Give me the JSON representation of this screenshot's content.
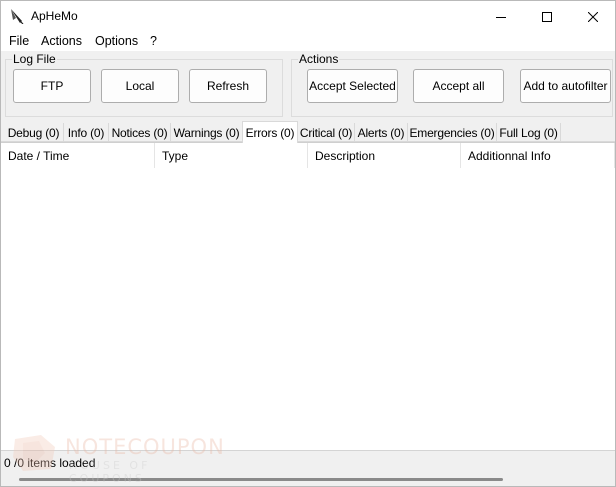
{
  "window": {
    "title": "ApHeMo"
  },
  "menu": [
    {
      "label": "File"
    },
    {
      "label": "Actions"
    },
    {
      "label": "Options"
    },
    {
      "label": "?"
    }
  ],
  "log_file": {
    "label": "Log File",
    "buttons": [
      "FTP",
      "Local",
      "Refresh"
    ]
  },
  "actions": {
    "label": "Actions",
    "buttons": [
      "Accept Selected",
      "Accept all",
      "Add to autofilter"
    ]
  },
  "tabs": [
    {
      "label": "Debug (0)"
    },
    {
      "label": "Info (0)"
    },
    {
      "label": "Notices (0)"
    },
    {
      "label": "Warnings (0)"
    },
    {
      "label": "Errors (0)",
      "active": true
    },
    {
      "label": "Critical (0)"
    },
    {
      "label": "Alerts (0)"
    },
    {
      "label": "Emergencies (0)"
    },
    {
      "label": "Full Log (0)"
    }
  ],
  "table": {
    "columns": [
      "Date / Time",
      "Type",
      "Description",
      "Additionnal Info"
    ],
    "rows": []
  },
  "status": {
    "text": "0 /0 items loaded"
  },
  "watermark": {
    "name": "NOTECOUPON",
    "tagline": "HOUSE OF COUPONS"
  },
  "colors": {
    "background": "#f0f0f0",
    "titlebar": "#ffffff",
    "button_border": "#adadad",
    "watermark_accent": "#e9b6a2"
  },
  "icons": [
    "app-feather-icon",
    "minimize-icon",
    "maximize-icon",
    "close-icon"
  ]
}
